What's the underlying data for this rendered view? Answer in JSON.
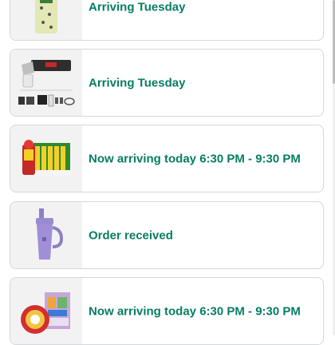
{
  "orders": [
    {
      "status": "Arriving Tuesday",
      "image": "sponge-package-image"
    },
    {
      "status": "Arriving Tuesday",
      "image": "garage-door-opener-kit-image"
    },
    {
      "status": "Now arriving today 6:30 PM - 9:30 PM",
      "image": "juice-box-pack-image"
    },
    {
      "status": "Order received",
      "image": "purple-tumbler-image"
    },
    {
      "status": "Now arriving today 6:30 PM - 9:30 PM",
      "image": "snack-and-toy-bundle-image"
    }
  ],
  "colors": {
    "status_text": "#067d62",
    "card_border": "#d5d9d9",
    "thumbnail_bg": "#f2f2f2"
  }
}
